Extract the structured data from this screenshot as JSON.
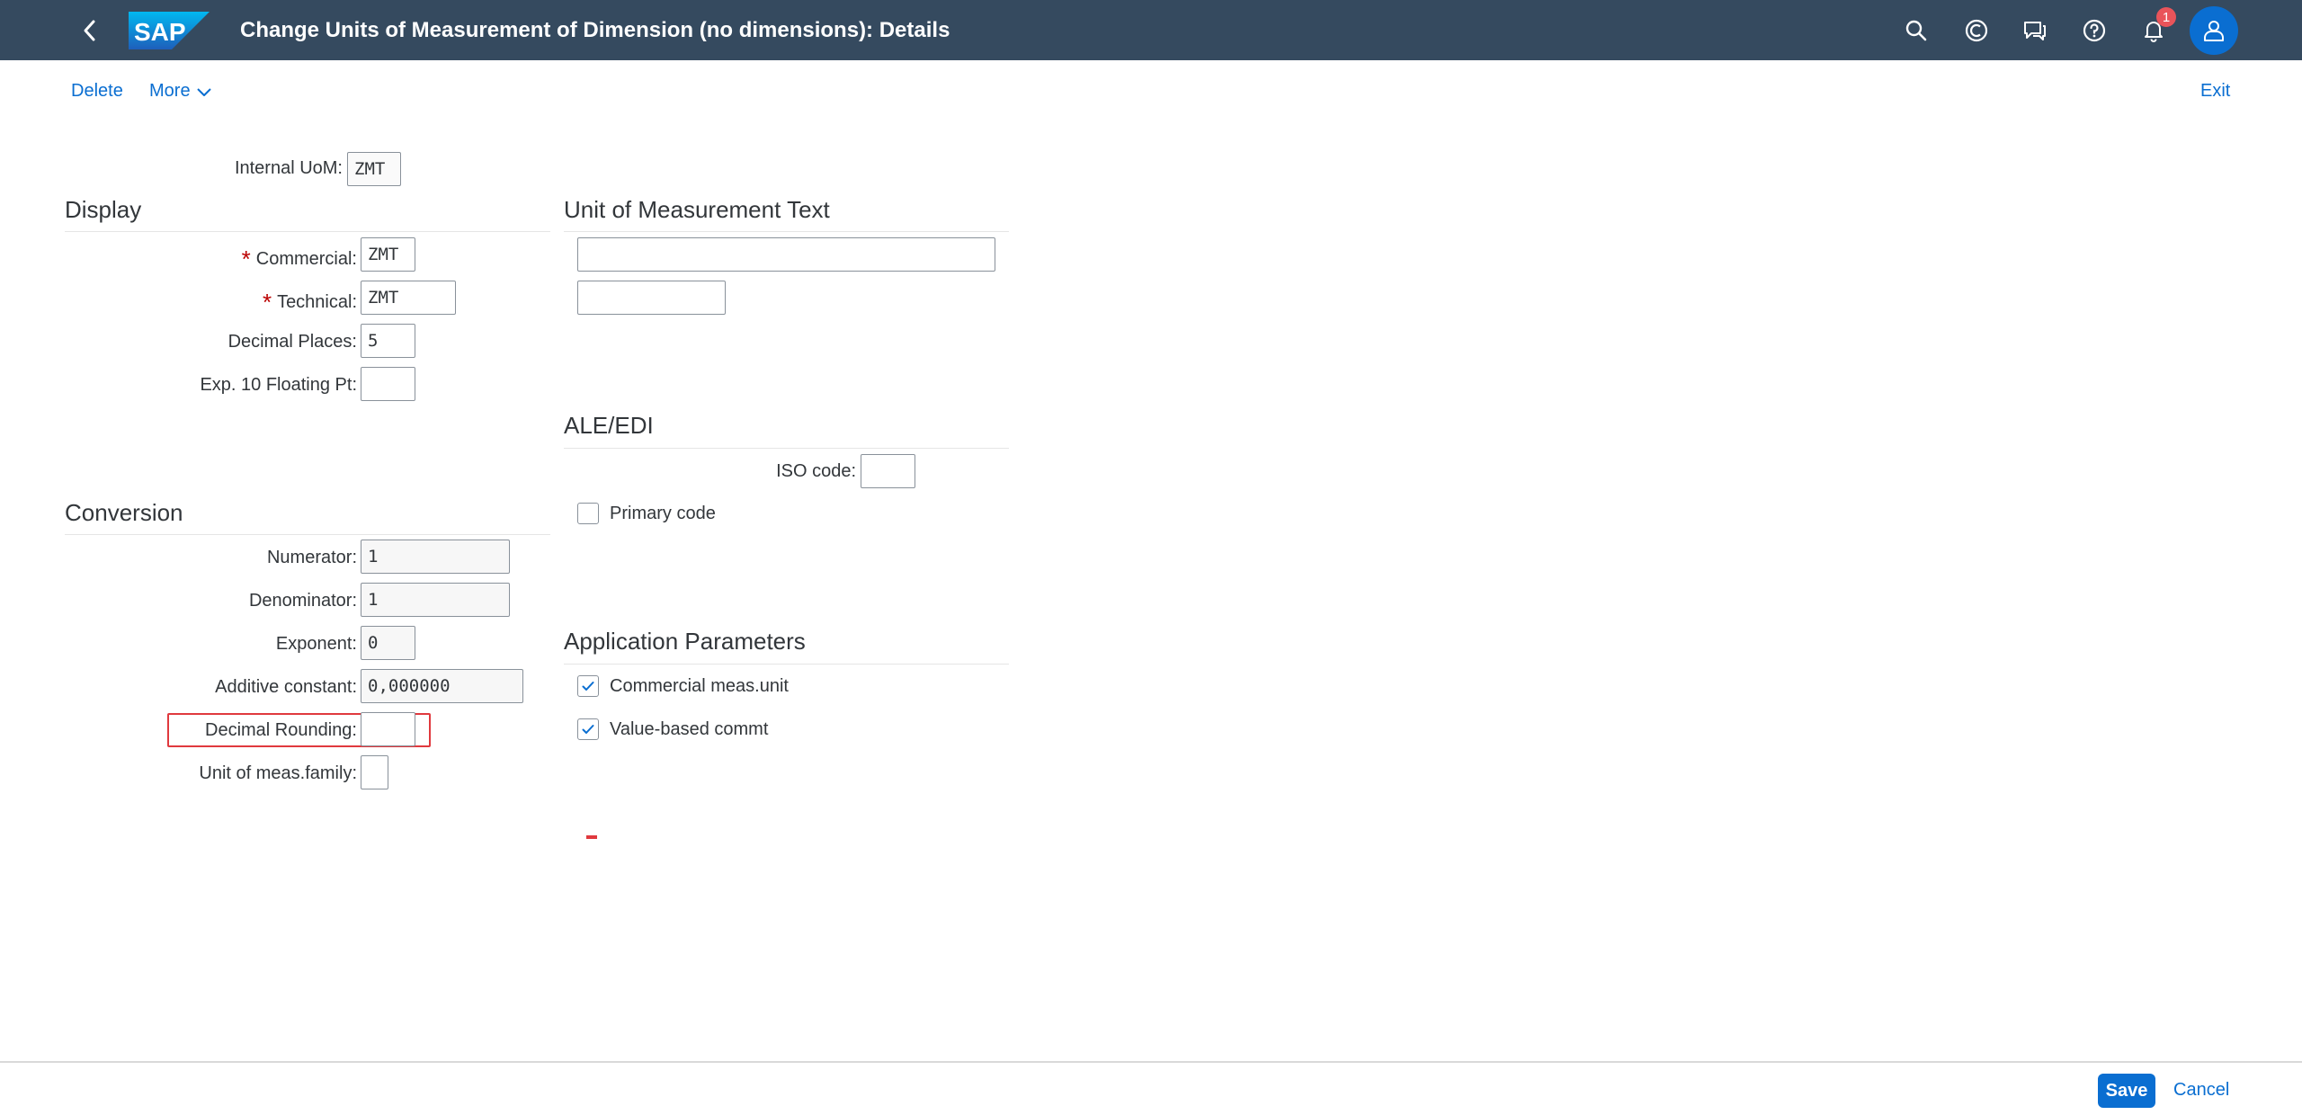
{
  "shell": {
    "title": "Change Units of Measurement of Dimension (no dimensions): Details",
    "notification_count": "1",
    "logo_text": "SAP"
  },
  "toolbar": {
    "delete_label": "Delete",
    "more_label": "More",
    "exit_label": "Exit"
  },
  "header_field": {
    "label": "Internal UoM:",
    "value": "ZMT"
  },
  "display": {
    "title": "Display",
    "commercial": {
      "label": "Commercial:",
      "value": "ZMT"
    },
    "technical": {
      "label": "Technical:",
      "value": "ZMT"
    },
    "decimal_places": {
      "label": "Decimal Places:",
      "value": "5"
    },
    "exp10": {
      "label": "Exp. 10 Floating Pt:",
      "value": ""
    }
  },
  "uom_text": {
    "title": "Unit of Measurement Text",
    "long_text": "",
    "short_text": ""
  },
  "ale_edi": {
    "title": "ALE/EDI",
    "iso_code": {
      "label": "ISO code:",
      "value": ""
    },
    "primary_code": {
      "label": "Primary code",
      "checked": false
    }
  },
  "conversion": {
    "title": "Conversion",
    "numerator": {
      "label": "Numerator:",
      "value": "1"
    },
    "denominator": {
      "label": "Denominator:",
      "value": "1"
    },
    "exponent": {
      "label": "Exponent:",
      "value": "0"
    },
    "additive_constant": {
      "label": "Additive constant:",
      "value": "0,000000"
    },
    "decimal_rounding": {
      "label": "Decimal Rounding:",
      "value": ""
    },
    "uom_family": {
      "label": "Unit of meas.family:",
      "value": ""
    }
  },
  "app_params": {
    "title": "Application Parameters",
    "commercial_meas_unit": {
      "label": "Commercial meas.unit",
      "checked": true
    },
    "value_based_commt": {
      "label": "Value-based commt",
      "checked": true
    }
  },
  "footer": {
    "save_label": "Save",
    "cancel_label": "Cancel"
  },
  "colors": {
    "shell_bg": "#354a5f",
    "accent": "#0a6ed1",
    "required": "#bb0000",
    "highlight": "#e0393e"
  }
}
